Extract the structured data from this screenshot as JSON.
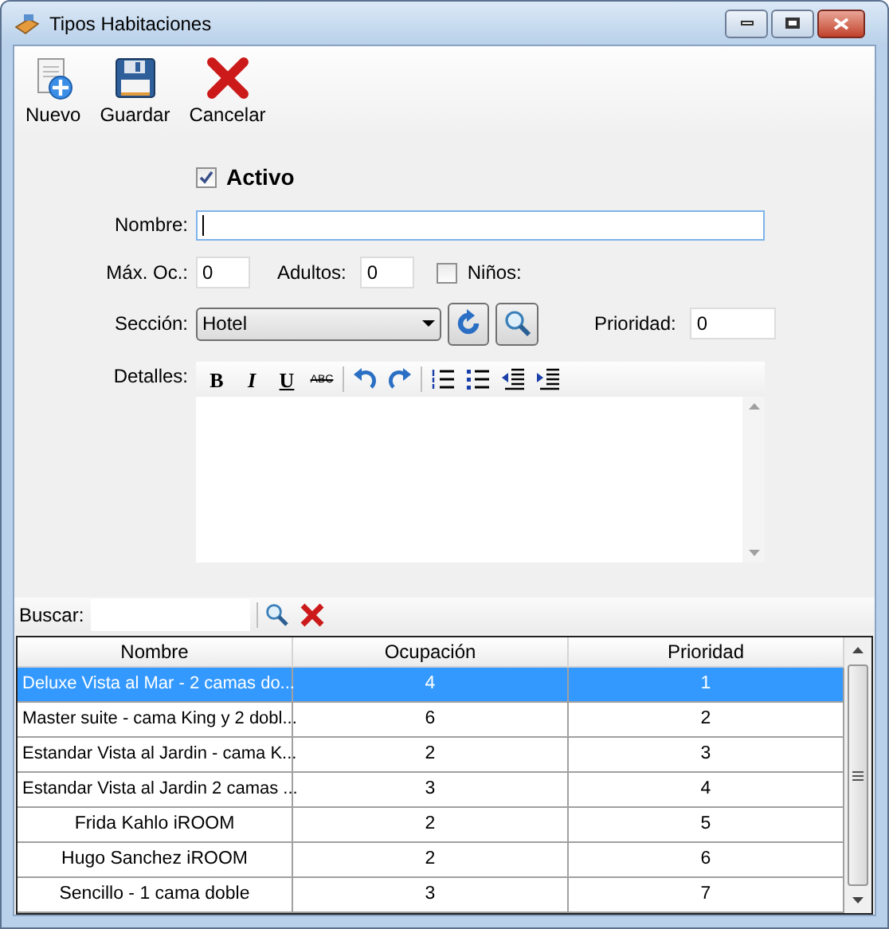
{
  "window": {
    "title": "Tipos Habitaciones"
  },
  "toolbar": [
    {
      "label": "Nuevo",
      "kind": "new"
    },
    {
      "label": "Guardar",
      "kind": "save"
    },
    {
      "label": "Cancelar",
      "kind": "cancel"
    }
  ],
  "form": {
    "activo": {
      "label": "Activo",
      "checked": true
    },
    "nombre": {
      "label": "Nombre:"
    },
    "max_oc": {
      "label": "Máx. Oc.:",
      "value": "0"
    },
    "adultos": {
      "label": "Adultos:",
      "value": "0"
    },
    "ninos": {
      "label": "Niños:",
      "checked": false
    },
    "seccion": {
      "label": "Sección:",
      "value": "Hotel"
    },
    "prioridad": {
      "label": "Prioridad:",
      "value": "0"
    },
    "detalles": {
      "label": "Detalles:",
      "format_buttons": [
        {
          "label": "B",
          "kind": "bold"
        },
        {
          "label": "I",
          "kind": "italic"
        },
        {
          "label": "U",
          "kind": "underline"
        },
        {
          "label": "ABC",
          "kind": "strike"
        }
      ]
    }
  },
  "search": {
    "label": "Buscar:"
  },
  "table": {
    "columns": [
      "Nombre",
      "Ocupación",
      "Prioridad"
    ],
    "rows": [
      {
        "cells": [
          "Deluxe Vista al Mar - 2 camas do...",
          "4",
          "1"
        ],
        "selected": true,
        "truncated": true
      },
      {
        "cells": [
          "Master suite - cama King y 2 dobl...",
          "6",
          "2"
        ],
        "selected": false,
        "truncated": true
      },
      {
        "cells": [
          "Estandar Vista al Jardin - cama K...",
          "2",
          "3"
        ],
        "selected": false,
        "truncated": true
      },
      {
        "cells": [
          "Estandar Vista al Jardin 2 camas ...",
          "3",
          "4"
        ],
        "selected": false,
        "truncated": true
      },
      {
        "cells": [
          "Frida Kahlo iROOM",
          "2",
          "5"
        ],
        "selected": false,
        "truncated": false
      },
      {
        "cells": [
          "Hugo Sanchez iROOM",
          "2",
          "6"
        ],
        "selected": false,
        "truncated": false
      },
      {
        "cells": [
          "Sencillo - 1 cama doble",
          "3",
          "7"
        ],
        "selected": false,
        "truncated": false
      }
    ]
  }
}
